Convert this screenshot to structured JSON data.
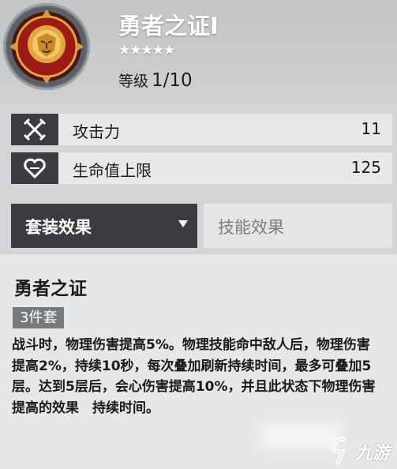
{
  "item": {
    "name": "勇者之证I",
    "stars": "★★★★★",
    "level_label": "等级",
    "level_value": "1/10"
  },
  "stats": [
    {
      "icon": "crossed-swords-icon",
      "name": "攻击力",
      "value": "11"
    },
    {
      "icon": "heart-icon",
      "name": "生命值上限",
      "value": "125"
    }
  ],
  "tabs": {
    "active_label": "套装效果",
    "inactive_label": "技能效果"
  },
  "set": {
    "name": "勇者之证",
    "badge": "3件套",
    "effect": "战斗时，物理伤害提高5%。物理技能命中敌人后，物理伤害提高2%，持续10秒，每次叠加刷新持续时间，最多可叠加5层。达到5层后，会心伤害提高10%，并且此状态下物理伤害提高的效果　持续时间。"
  },
  "watermark": {
    "text": "九游"
  },
  "colors": {
    "dark_panel": "#3a3c3f",
    "emblem_red": "#b0201a",
    "emblem_gold": "#e8b24a"
  }
}
